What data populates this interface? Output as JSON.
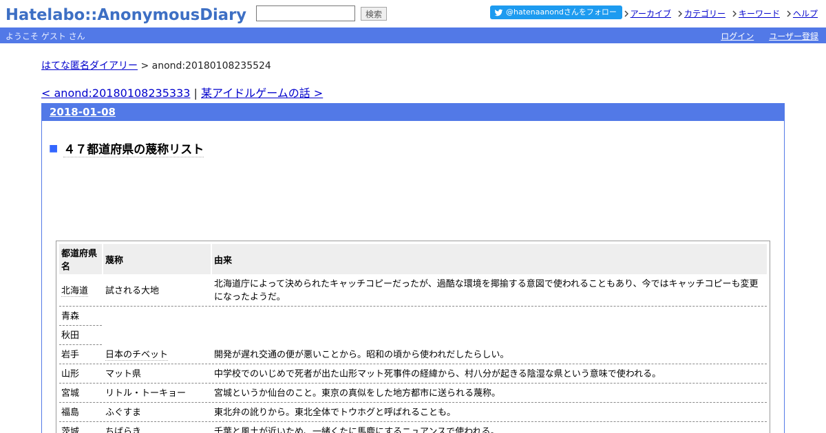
{
  "header": {
    "logo_text": "Hatelabo::AnonymousDiary",
    "search": {
      "value": "",
      "button_label": "検索"
    },
    "follow_label": "@hatenaanondさんをフォロー",
    "links": [
      "アーカイブ",
      "カテゴリー",
      "キーワード",
      "ヘルプ"
    ],
    "colors": {
      "logo": "#3d6fc4",
      "bar": "#5279e7",
      "follow": "#1d9bf0"
    }
  },
  "bar": {
    "welcome": "ようこそ ゲスト さん",
    "login": "ログイン",
    "register": "ユーザー登録"
  },
  "breadcrumb": {
    "home": "はてな匿名ダイアリー",
    "separator": " > ",
    "current": "anond:20180108235524"
  },
  "pager": {
    "prev": "< anond:20180108235333",
    "separator": " | ",
    "next": "某アイドルゲームの話 >"
  },
  "day": {
    "date": "2018-01-08",
    "entry_mark": "■",
    "entry_title": "４７都道府県の蔑称リスト"
  },
  "table": {
    "headers": [
      "都道府県名",
      "蔑称",
      "由来"
    ],
    "rows": [
      {
        "pref": "北海道",
        "nick": "試される大地",
        "origin": "北海道庁によって決められたキャッチコピーだったが、過酷な環境を揶揄する意図で使われることもあり、今ではキャッチコピーも変更になったようだ。"
      },
      {
        "pref": "青森",
        "nick": "",
        "origin": ""
      },
      {
        "pref": "秋田",
        "nick": "",
        "origin": ""
      },
      {
        "pref": "岩手",
        "nick": "日本のチベット",
        "origin": "開発が遅れ交通の便が悪いことから。昭和の頃から使われだしたらしい。"
      },
      {
        "pref": "山形",
        "nick": "マット県",
        "origin": "中学校でのいじめで死者が出た山形マット死事件の経緯から、村八分が起きる陰湿な県という意味で使われる。"
      },
      {
        "pref": "宮城",
        "nick": "リトル・トーキョー",
        "origin": "宮城というか仙台のこと。東京の真似をした地方都市に送られる蔑称。"
      },
      {
        "pref": "福島",
        "nick": "ふぐすま",
        "origin": "東北弁の訛りから。東北全体でトウホグと呼ばれることも。"
      },
      {
        "pref": "茨城",
        "nick": "ちばらき",
        "origin": "千葉と風土が近いため、一緒くたに馬鹿にするニュアンスで使われる。"
      }
    ]
  }
}
